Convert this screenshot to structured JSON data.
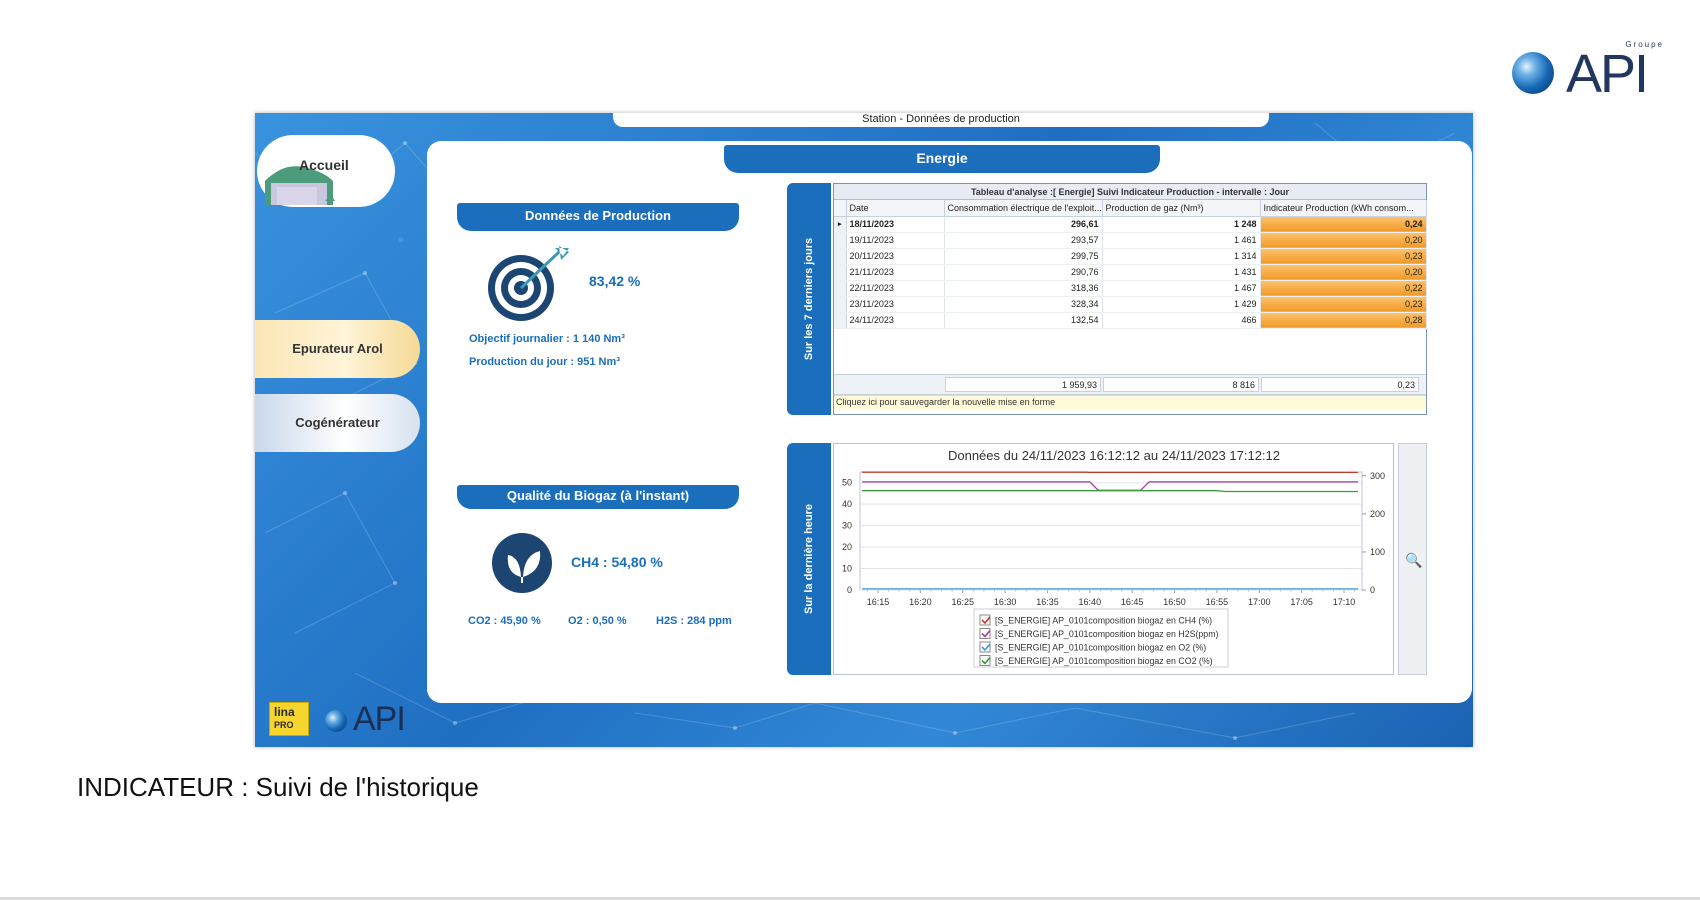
{
  "brand": {
    "groupe": "Groupe",
    "name": "API"
  },
  "window": {
    "title": "Station - Données de production"
  },
  "nav": {
    "home": "Accueil",
    "items": [
      "Epurateur Arol",
      "Cogénérateur"
    ]
  },
  "footer_logos": {
    "lina": "lina",
    "pro": "PRO",
    "api": "API"
  },
  "section_title": "Energie",
  "production": {
    "header": "Données de Production",
    "rate": "83,42 %",
    "objective": "Objectif journalier : 1 140 Nm³",
    "today": "Production du jour : 951 Nm³"
  },
  "biogas": {
    "header": "Qualité du Biogaz (à l'instant)",
    "ch4": "CH4 : 54,80 %",
    "co2": "CO2 : 45,90 %",
    "o2": "O2 : 0,50 %",
    "h2s": "H2S : 284 ppm"
  },
  "tabs": {
    "week": "Sur les 7 derniers jours",
    "hour": "Sur la dernière heure"
  },
  "table": {
    "caption": "Tableau d'analyse :[ Energie] Suivi Indicateur Production - intervalle : Jour",
    "columns": [
      "Date",
      "Consommation électrique de l'exploit...",
      "Production de gaz (Nm³)",
      "Indicateur Production (kWh consom..."
    ],
    "rows": [
      [
        "18/11/2023",
        "296,61",
        "1 248",
        "0,24"
      ],
      [
        "19/11/2023",
        "293,57",
        "1 461",
        "0,20"
      ],
      [
        "20/11/2023",
        "299,75",
        "1 314",
        "0,23"
      ],
      [
        "21/11/2023",
        "290,76",
        "1 431",
        "0,20"
      ],
      [
        "22/11/2023",
        "318,36",
        "1 467",
        "0,22"
      ],
      [
        "23/11/2023",
        "328,34",
        "1 429",
        "0,23"
      ],
      [
        "24/11/2023",
        "132,54",
        "466",
        "0,28"
      ]
    ],
    "totals": [
      "1 959,93",
      "8 816",
      "0,23"
    ],
    "hint": "Cliquez ici pour sauvegarder la nouvelle mise en forme"
  },
  "chart_data": {
    "type": "line",
    "title": "Données du 24/11/2023 16:12:12 au 24/11/2023 17:12:12",
    "x": [
      "16:15",
      "16:20",
      "16:25",
      "16:30",
      "16:35",
      "16:40",
      "16:45",
      "16:50",
      "16:55",
      "17:00",
      "17:05",
      "17:10"
    ],
    "y_left_ticks": [
      0,
      10,
      20,
      30,
      40,
      50
    ],
    "y_right_ticks": [
      0,
      100,
      200,
      300
    ],
    "ylim_left": [
      0,
      55
    ],
    "ylim_right": [
      0,
      310
    ],
    "series": [
      {
        "name": "[S_ENERGIE] AP_0101composition biogaz en CH4 (%)",
        "color": "#c0392b",
        "axis": "left",
        "points": [
          [
            0,
            54.9
          ],
          [
            5.5,
            54.9
          ],
          [
            5.6,
            54.8
          ],
          [
            12,
            54.8
          ]
        ]
      },
      {
        "name": "[S_ENERGIE] AP_0101composition biogaz en H2S(ppm)",
        "color": "#a43aa4",
        "axis": "right",
        "points": [
          [
            0,
            284
          ],
          [
            5.6,
            284
          ],
          [
            5.8,
            262
          ],
          [
            6.8,
            262
          ],
          [
            7.0,
            284
          ],
          [
            12,
            284
          ]
        ]
      },
      {
        "name": "[S_ENERGIE] AP_0101composition biogaz en O2 (%)",
        "color": "#3a9bd6",
        "axis": "left",
        "points": [
          [
            0,
            0.5
          ],
          [
            12,
            0.5
          ]
        ]
      },
      {
        "name": "[S_ENERGIE] AP_0101composition biogaz en CO2 (%)",
        "color": "#3c9a3c",
        "axis": "left",
        "points": [
          [
            0,
            46.3
          ],
          [
            8.6,
            46.3
          ],
          [
            8.8,
            45.9
          ],
          [
            12,
            45.9
          ]
        ]
      }
    ]
  },
  "caption": "INDICATEUR : Suivi de l'historique"
}
